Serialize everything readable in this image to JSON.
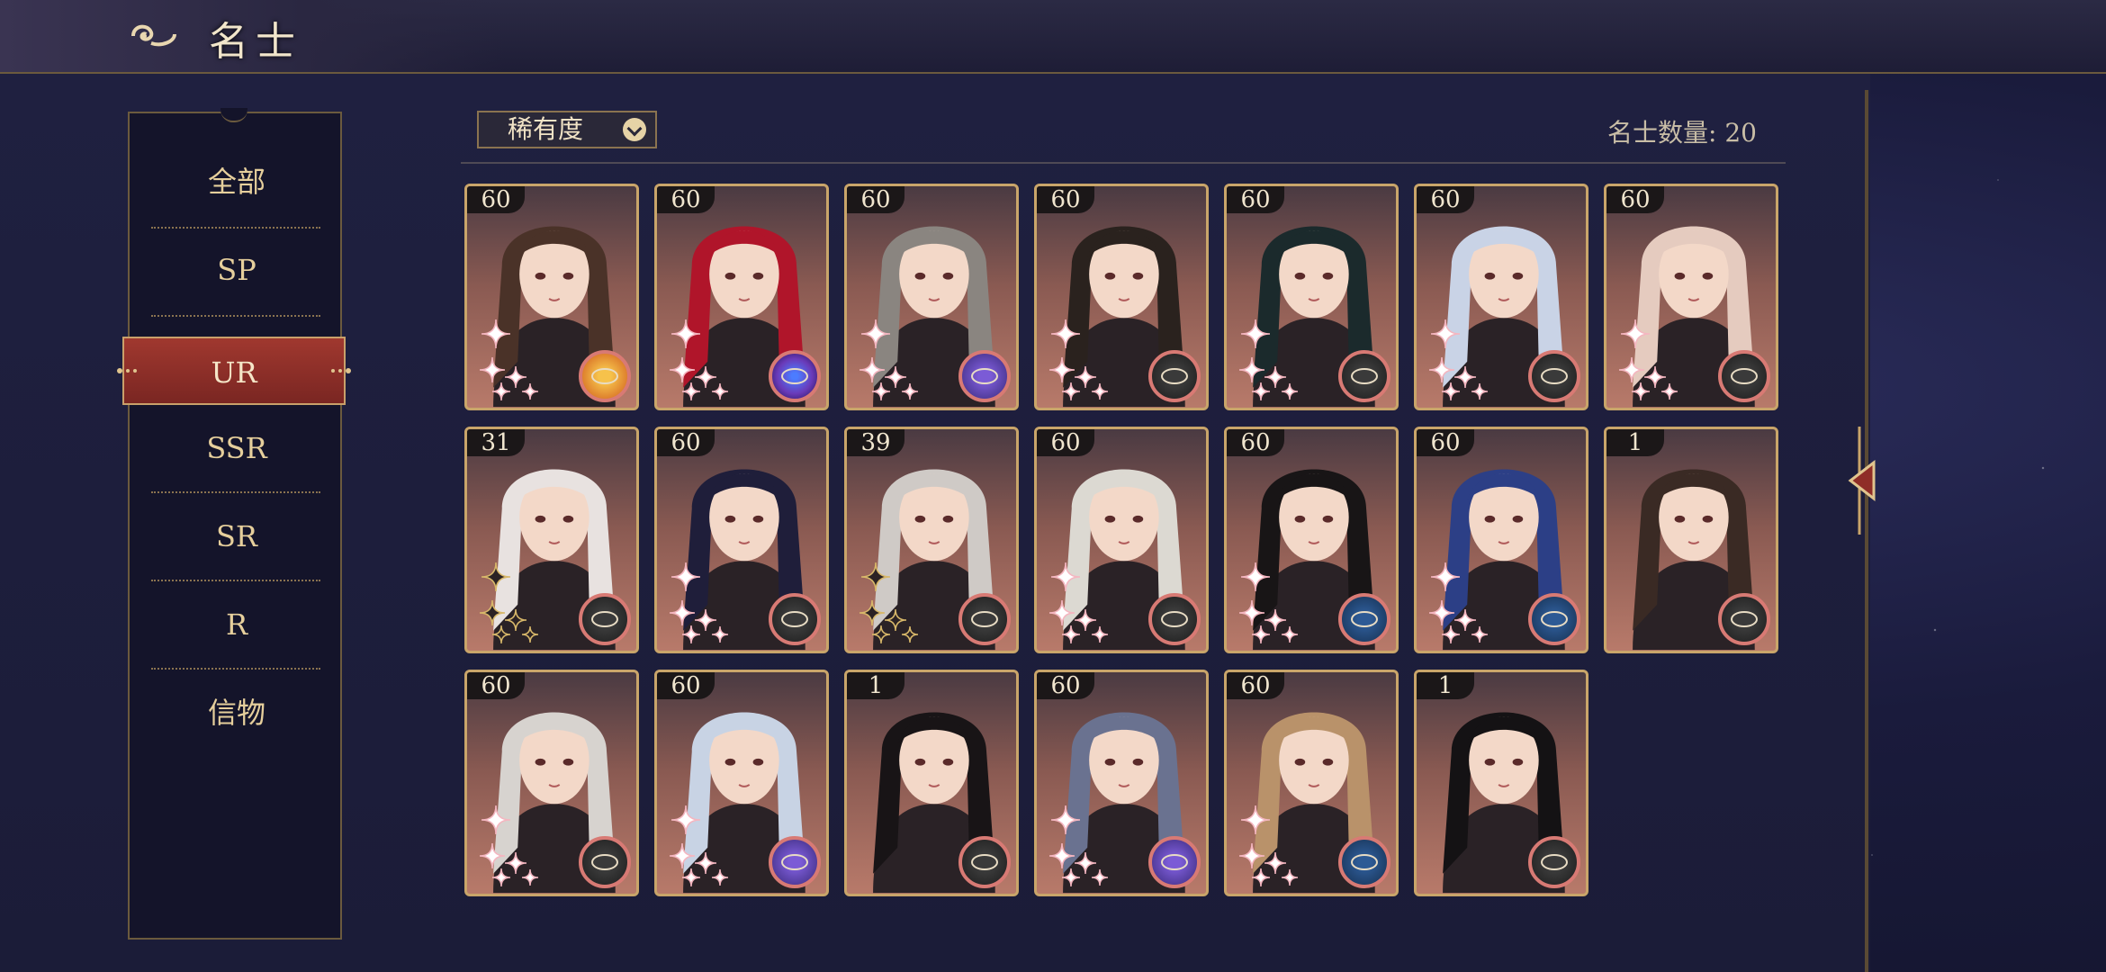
{
  "header": {
    "title": "名士"
  },
  "sidebar": {
    "items": [
      {
        "label": "全部",
        "active": false
      },
      {
        "label": "SP",
        "active": false
      },
      {
        "label": "UR",
        "active": true
      },
      {
        "label": "SSR",
        "active": false
      },
      {
        "label": "SR",
        "active": false
      },
      {
        "label": "R",
        "active": false
      },
      {
        "label": "信物",
        "active": false
      }
    ]
  },
  "filter": {
    "label": "稀有度",
    "icon": "chevron-down-icon"
  },
  "count": {
    "label": "名士数量: 20"
  },
  "cards": [
    {
      "level": "60",
      "badge": "orange",
      "hair": "#4a3228",
      "stars": "white"
    },
    {
      "level": "60",
      "badge": "cosmic",
      "hair": "#b0152a",
      "stars": "white"
    },
    {
      "level": "60",
      "badge": "purple",
      "hair": "#8a8580",
      "stars": "white"
    },
    {
      "level": "60",
      "badge": "grey",
      "hair": "#2a221e",
      "stars": "white"
    },
    {
      "level": "60",
      "badge": "grey",
      "hair": "#1b2a2c",
      "stars": "white"
    },
    {
      "level": "60",
      "badge": "grey",
      "hair": "#c9d3e6",
      "stars": "white"
    },
    {
      "level": "60",
      "badge": "grey",
      "hair": "#e5cbbf",
      "stars": "white"
    },
    {
      "level": "31",
      "badge": "grey",
      "hair": "#e8e2e0",
      "stars": "dark"
    },
    {
      "level": "60",
      "badge": "grey",
      "hair": "#1f1e3a",
      "stars": "white"
    },
    {
      "level": "39",
      "badge": "grey",
      "hair": "#cfcac6",
      "stars": "dark"
    },
    {
      "level": "60",
      "badge": "grey",
      "hair": "#dcd9d2",
      "stars": "white"
    },
    {
      "level": "60",
      "badge": "blue",
      "hair": "#181516",
      "stars": "white"
    },
    {
      "level": "60",
      "badge": "blue",
      "hair": "#2c3f86",
      "stars": "white"
    },
    {
      "level": "1",
      "badge": "grey",
      "hair": "#3a2a24",
      "stars": "none"
    },
    {
      "level": "60",
      "badge": "grey",
      "hair": "#d7d3cf",
      "stars": "white"
    },
    {
      "level": "60",
      "badge": "purple",
      "hair": "#c8d3e4",
      "stars": "white"
    },
    {
      "level": "1",
      "badge": "grey",
      "hair": "#181416",
      "stars": "none"
    },
    {
      "level": "60",
      "badge": "purple",
      "hair": "#6a7290",
      "stars": "white"
    },
    {
      "level": "60",
      "badge": "blue",
      "hair": "#b9926a",
      "stars": "white"
    },
    {
      "level": "1",
      "badge": "grey",
      "hair": "#141214",
      "stars": "none"
    }
  ],
  "colors": {
    "accent_gold": "#c9a56a",
    "active_red": "#8f2d27",
    "badge_ring": "#d87a74"
  }
}
